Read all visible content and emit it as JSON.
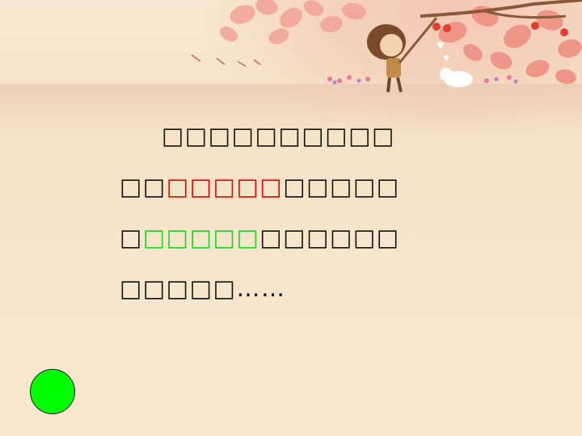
{
  "slide": {
    "lines": [
      {
        "text": "□□□□□□□□□□"
      },
      {
        "segments": [
          {
            "text": "□□",
            "color": "default"
          },
          {
            "text": "□□□□□",
            "color": "#e60000"
          },
          {
            "text": "□□□□□",
            "color": "default"
          }
        ]
      },
      {
        "segments": [
          {
            "text": "□",
            "color": "default"
          },
          {
            "text": "□□□□□",
            "color": "#22d322"
          },
          {
            "text": "□□□□□□",
            "color": "default"
          }
        ]
      },
      {
        "text": "□□□□□……"
      }
    ]
  },
  "colors": {
    "background": "#f6e6cb",
    "text": "#111111",
    "highlight_red": "#e60000",
    "highlight_green": "#22d322",
    "button": "#00ff00"
  },
  "decor": {
    "header_illustration": "autumn-tree-girl-picking-apples-with-cat"
  }
}
